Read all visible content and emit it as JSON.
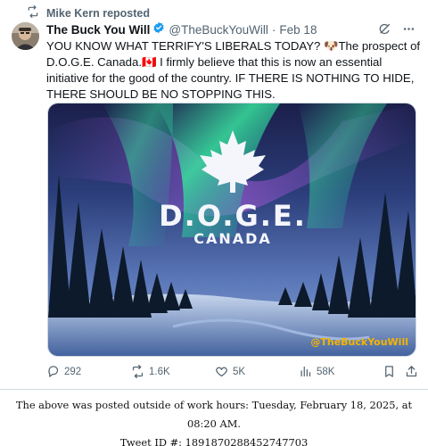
{
  "repost": {
    "text": "Mike Kern reposted",
    "icon": "repost-icon"
  },
  "author": {
    "name": "The Buck You Will",
    "handle": "@TheBuckYouWill",
    "separator": "·",
    "date": "Feb 18",
    "verified_color": "#1d9bf0"
  },
  "tweet": {
    "text": "YOU KNOW WHAT TERRIFY'S LIBERALS TODAY? 🐶The prospect of D.O.G.E. Canada.🇨🇦 I firmly believe that this is now an essential initiative for the good of the country. IF THERE IS NOTHING TO HIDE, THERE SHOULD BE NO STOPPING THIS."
  },
  "media": {
    "title": "D.O.G.E.",
    "subtitle": "CANADA",
    "watermark": "@TheBuckYouWill",
    "watermark_color": "#f5b400"
  },
  "actions": {
    "replies": "292",
    "reposts": "1.6K",
    "likes": "5K",
    "views": "58K"
  },
  "footer": {
    "line1": "The above was posted outside of work hours: Tuesday, February 18, 2025, at 08:20 AM.",
    "line2": "Tweet ID #: 1891870288452747703"
  }
}
